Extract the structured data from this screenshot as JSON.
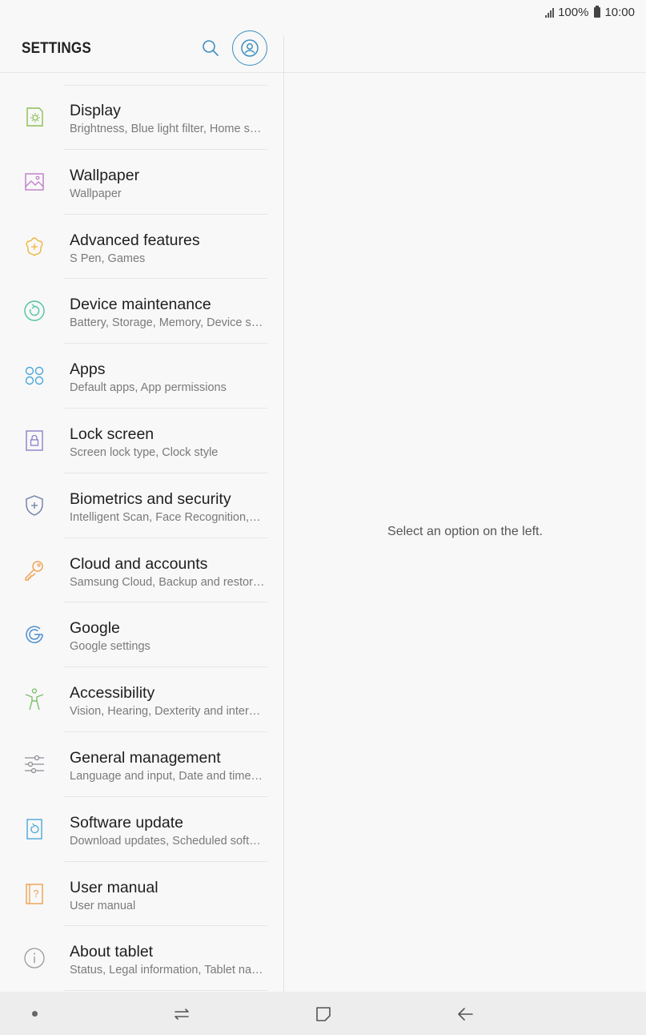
{
  "status": {
    "battery": "100%",
    "time": "10:00"
  },
  "header": {
    "title": "SETTINGS"
  },
  "items": [
    {
      "label": "Display",
      "sub": "Brightness, Blue light filter, Home sc…",
      "icon": "display-icon",
      "color": "#8bbf52"
    },
    {
      "label": "Wallpaper",
      "sub": "Wallpaper",
      "icon": "wallpaper-icon",
      "color": "#c07ac9"
    },
    {
      "label": "Advanced features",
      "sub": "S Pen, Games",
      "icon": "advanced-features-icon",
      "color": "#f0b43c"
    },
    {
      "label": "Device maintenance",
      "sub": "Battery, Storage, Memory, Device se…",
      "icon": "device-maintenance-icon",
      "color": "#4fc3a1"
    },
    {
      "label": "Apps",
      "sub": "Default apps, App permissions",
      "icon": "apps-icon",
      "color": "#4aa8d8"
    },
    {
      "label": "Lock screen",
      "sub": "Screen lock type, Clock style",
      "icon": "lock-icon",
      "color": "#8c7fc8"
    },
    {
      "label": "Biometrics and security",
      "sub": "Intelligent Scan, Face Recognition,…",
      "icon": "shield-icon",
      "color": "#6b7fa8"
    },
    {
      "label": "Cloud and accounts",
      "sub": "Samsung Cloud, Backup and restor…",
      "icon": "key-icon",
      "color": "#f0a050"
    },
    {
      "label": "Google",
      "sub": "Google settings",
      "icon": "google-icon",
      "color": "#4b8fd0"
    },
    {
      "label": "Accessibility",
      "sub": "Vision, Hearing, Dexterity and intera…",
      "icon": "accessibility-icon",
      "color": "#7cbf6a"
    },
    {
      "label": "General management",
      "sub": "Language and input, Date and time,…",
      "icon": "sliders-icon",
      "color": "#8a8f96"
    },
    {
      "label": "Software update",
      "sub": "Download updates, Scheduled soft…",
      "icon": "software-update-icon",
      "color": "#4aa8d8"
    },
    {
      "label": "User manual",
      "sub": "User manual",
      "icon": "user-manual-icon",
      "color": "#f0a050"
    },
    {
      "label": "About tablet",
      "sub": "Status, Legal information, Tablet na…",
      "icon": "info-icon",
      "color": "#9a9a9a"
    }
  ],
  "detail": {
    "message": "Select an option on the left."
  },
  "colors": {
    "accent": "#3d8fbf"
  }
}
